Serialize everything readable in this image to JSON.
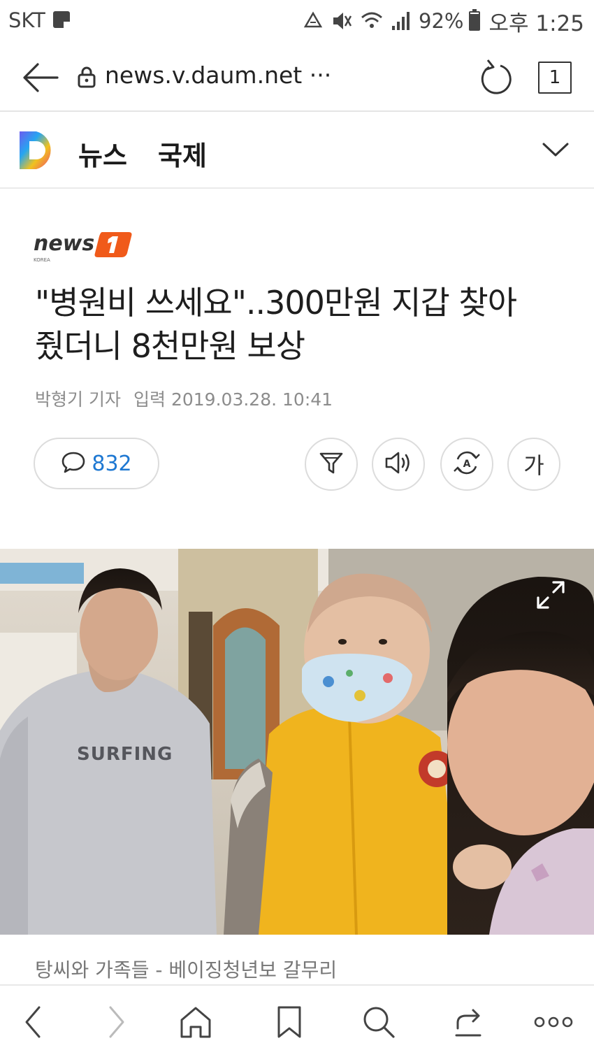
{
  "status_bar": {
    "carrier": "SKT",
    "battery_percent": "92%",
    "battery_level": 0.92,
    "time": "오후 1:25",
    "icons": [
      "note-icon",
      "recycle-icon",
      "mute-icon",
      "wifi-icon",
      "signal-icon",
      "battery-icon"
    ]
  },
  "browser": {
    "url": "news.v.daum.net ···",
    "tab_count": "1",
    "icons": [
      "back-arrow-icon",
      "lock-icon",
      "reload-icon"
    ]
  },
  "section": {
    "nav_label": "뉴스",
    "category": "국제",
    "icons": [
      "daum-logo",
      "chevron-down-icon"
    ]
  },
  "article": {
    "publisher_logo_text": "news1 KOREA",
    "headline_line1": "\"병원비 쓰세요\"..300만원 지갑 찾아",
    "headline_line2": "줬더니 8천만원 보상",
    "reporter": "박형기 기자",
    "date_label": "입력",
    "date": "2019.03.28. 10:41",
    "comment_count": "832",
    "font_button_label": "가",
    "toolbar_icons": [
      "comment-icon",
      "filter-icon",
      "speaker-icon",
      "translate-icon",
      "font-size-icon"
    ],
    "photo_caption": "탕씨와 가족들 - 베이징청년보 갈무리",
    "photo_text": "SURFING"
  },
  "bottom_nav": {
    "icons": [
      "nav-back-icon",
      "nav-forward-icon",
      "home-icon",
      "bookmark-icon",
      "search-icon",
      "share-icon",
      "more-icon"
    ]
  },
  "colors": {
    "accent_blue": "#1e78d2",
    "news1_orange": "#f05a1a",
    "jacket_yellow": "#f0b41e",
    "text_gray": "#8c8c8c"
  }
}
